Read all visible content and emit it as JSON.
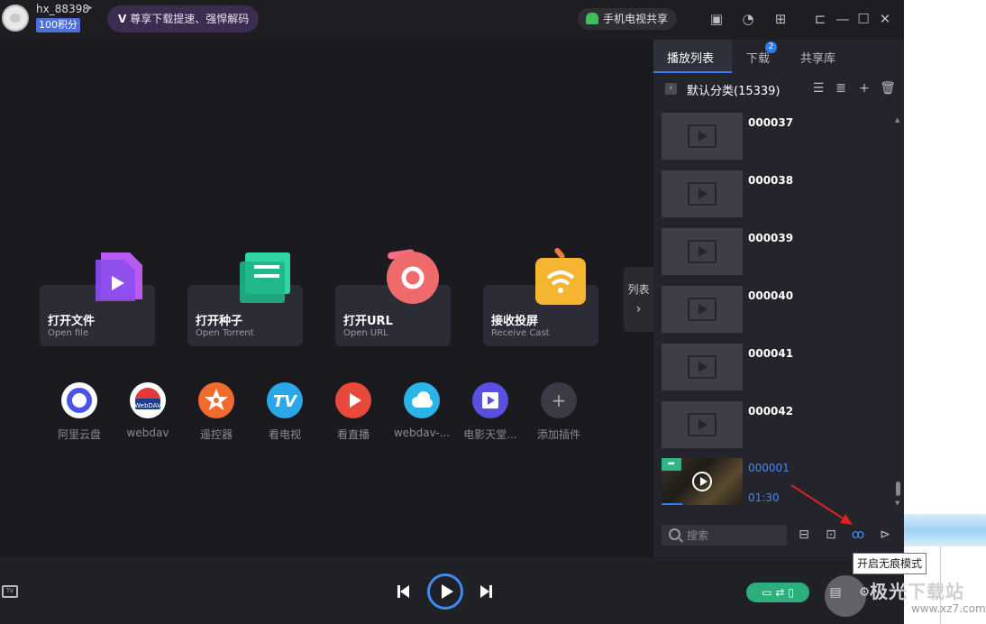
{
  "titlebar": {
    "username": "hx_88398",
    "points": "100积分",
    "vip_promo": "尊享下载提速、强悍解码",
    "vip_badge": "V",
    "android_share": "手机电视共享"
  },
  "main": {
    "cards": [
      {
        "title": "打开文件",
        "subtitle": "Open file"
      },
      {
        "title": "打开种子",
        "subtitle": "Open Torrent"
      },
      {
        "title": "打开URL",
        "subtitle": "Open URL"
      },
      {
        "title": "接收投屏",
        "subtitle": "Receive Cast"
      }
    ],
    "tools": [
      {
        "label": "阿里云盘",
        "color": "#ffffff"
      },
      {
        "label": "webdav",
        "color": "#ffffff"
      },
      {
        "label": "遥控器",
        "color": "#f26b2e"
      },
      {
        "label": "看电视",
        "color": "#2aa7e8"
      },
      {
        "label": "看直播",
        "color": "#e8493a"
      },
      {
        "label": "webdav-...",
        "color": "#2bb4e8"
      },
      {
        "label": "电影天堂...",
        "color": "#5b4fe0"
      },
      {
        "label": "添加插件",
        "color": "#3a3b44"
      }
    ],
    "tool_glyphs": {
      "tv": "TV",
      "webdav": "WebDAV",
      "add": "+"
    },
    "list_toggle": "列表"
  },
  "panel": {
    "tabs": [
      "播放列表",
      "下载",
      "共享库"
    ],
    "download_badge": "2",
    "category": "默认分类(15339)",
    "items": [
      {
        "name": "000037"
      },
      {
        "name": "000038"
      },
      {
        "name": "000039"
      },
      {
        "name": "000040"
      },
      {
        "name": "000041"
      },
      {
        "name": "000042"
      }
    ],
    "current": {
      "name": "000001",
      "duration": "01:30",
      "progress": 0.25
    },
    "search_placeholder": "搜索",
    "tooltip": "开启无痕模式"
  },
  "watermark": {
    "text": "极光下载站",
    "url": "www.xz7.com"
  },
  "colors": {
    "accent": "#3e8bf2",
    "share_green": "#2cae7d",
    "panel_bg": "#24252c",
    "main_bg": "#1a1a1f"
  }
}
